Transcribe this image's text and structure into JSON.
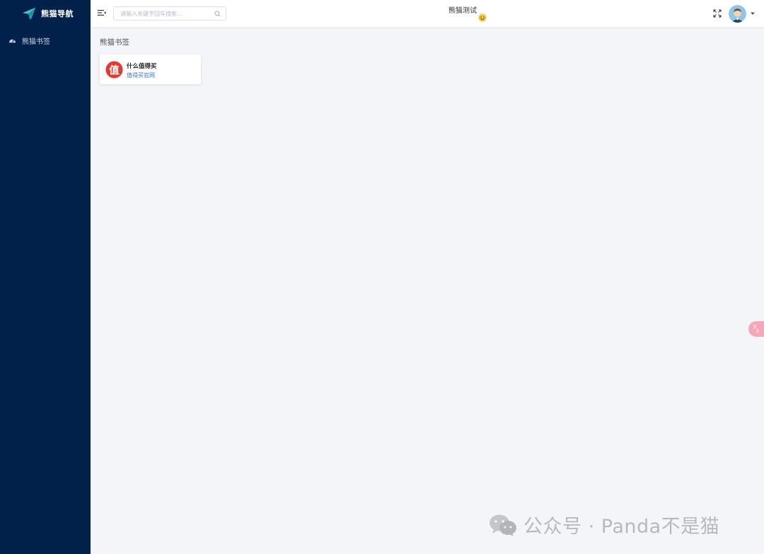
{
  "sidebar": {
    "brand_title": "熊猫导航",
    "brand_logo": "paper-plane-logo",
    "items": [
      {
        "label": "熊猫书签",
        "icon": "dashboard-gauge-icon"
      }
    ]
  },
  "header": {
    "search_placeholder": "请输入关键字回车搜索...",
    "title": "熊猫测试",
    "icons": [
      "collapse-menu-icon",
      "search-icon",
      "smiley-emoji-icon",
      "fullscreen-icon",
      "avatar",
      "caret-down-icon"
    ]
  },
  "main": {
    "section_title": "熊猫书签",
    "bookmarks": [
      {
        "name": "什么值得买",
        "desc": "值得买官网",
        "logo_char": "值",
        "logo_color": "#e6392f"
      }
    ]
  },
  "watermark": {
    "text": "公众号 · Panda不是猫"
  },
  "colors": {
    "sidebar_bg": "#02214a",
    "content_bg": "#f4f5f8",
    "link_blue": "#3a73c7",
    "accent_teal": "#3fc1c9"
  }
}
